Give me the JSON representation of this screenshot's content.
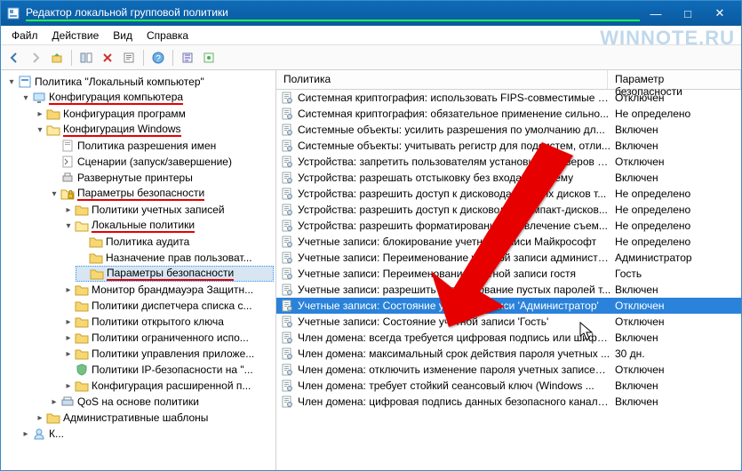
{
  "window": {
    "title": "Редактор локальной групповой политики"
  },
  "watermark": "WINNOTE.RU",
  "menu": {
    "file": "Файл",
    "action": "Действие",
    "view": "Вид",
    "help": "Справка"
  },
  "tree": {
    "root": "Политика \"Локальный компьютер\"",
    "computer_cfg": "Конфигурация компьютера",
    "software_cfg": "Конфигурация программ",
    "windows_cfg": "Конфигурация Windows",
    "name_res": "Политика разрешения имен",
    "scripts": "Сценарии (запуск/завершение)",
    "printers": "Развернутые принтеры",
    "sec_params": "Параметры безопасности",
    "account_pol": "Политики учетных записей",
    "local_pol": "Локальные политики",
    "audit": "Политика аудита",
    "rights": "Назначение прав пользоват...",
    "sec_options": "Параметры безопасности",
    "firewall": "Монитор брандмауэра Защитн...",
    "netlist": "Политики диспетчера списка с...",
    "pubkey": "Политики открытого ключа",
    "restricted": "Политики ограниченного испо...",
    "app_control": "Политики управления приложе...",
    "ipsec": "Политики IP-безопасности на \"...",
    "audit_adv": "Конфигурация расширенной п...",
    "qos": "QoS на основе политики",
    "admin_tpl": "Административные шаблоны",
    "user_cfg_stub": "К..."
  },
  "list": {
    "col_policy": "Политика",
    "col_param": "Параметр безопасности",
    "rows": [
      {
        "t": "Системная криптография: использовать FIPS-совместимые а...",
        "p": "Отключен"
      },
      {
        "t": "Системная криптография: обязательное применение сильно...",
        "p": "Не определено"
      },
      {
        "t": "Системные объекты: усилить разрешения по умолчанию дл...",
        "p": "Включен"
      },
      {
        "t": "Системные объекты: учитывать регистр для подсистем, отли...",
        "p": "Включен"
      },
      {
        "t": "Устройства: запретить пользователям установку драйверов п...",
        "p": "Отключен"
      },
      {
        "t": "Устройства: разрешать отстыковку без входа в систему",
        "p": "Включен"
      },
      {
        "t": "Устройства: разрешить доступ к дисководам гибких дисков т...",
        "p": "Не определено"
      },
      {
        "t": "Устройства: разрешить доступ к дисководам компакт-дисков...",
        "p": "Не определено"
      },
      {
        "t": "Устройства: разрешить форматирование и извлечение съем...",
        "p": "Не определено"
      },
      {
        "t": "Учетные записи: блокирование учетной записи Майкрософт",
        "p": "Не определено"
      },
      {
        "t": "Учетные записи: Переименование учетной записи администр...",
        "p": "Администратор"
      },
      {
        "t": "Учетные записи: Переименование учетной записи гостя",
        "p": "Гость"
      },
      {
        "t": "Учетные записи: разрешить использование пустых паролей т...",
        "p": "Включен"
      },
      {
        "t": "Учетные записи: Состояние учетной записи 'Администратор'",
        "p": "Отключен",
        "selected": true
      },
      {
        "t": "Учетные записи: Состояние учетной записи 'Гость'",
        "p": "Отключен"
      },
      {
        "t": "Член домена: всегда требуется цифровая подпись или шифр...",
        "p": "Включен"
      },
      {
        "t": "Член домена: максимальный срок действия пароля учетных ...",
        "p": "30 дн."
      },
      {
        "t": "Член домена: отключить изменение пароля учетных записей ...",
        "p": "Отключен"
      },
      {
        "t": "Член домена: требует стойкий сеансовый ключ (Windows ...",
        "p": "Включен"
      },
      {
        "t": "Член домена: цифровая подпись данных безопасного канала...",
        "p": "Включен"
      }
    ]
  }
}
